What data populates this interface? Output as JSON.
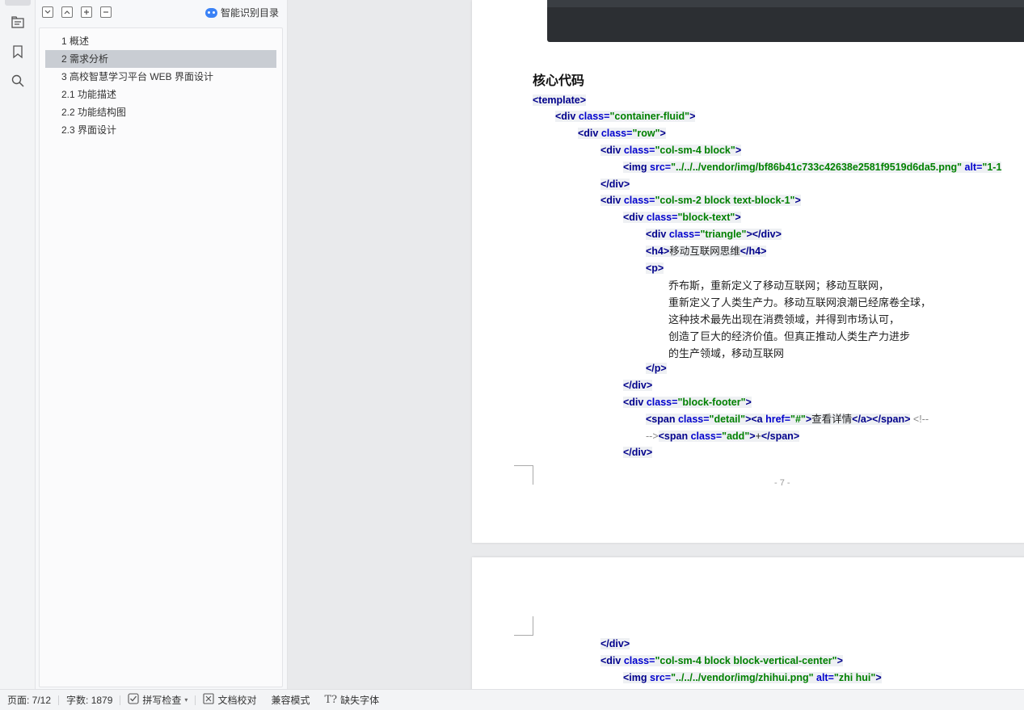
{
  "rail": {
    "icons": [
      "outline-icon",
      "bookmark-icon",
      "search-icon"
    ]
  },
  "panel": {
    "tools": [
      "collapse-all",
      "expand-up",
      "add",
      "remove"
    ],
    "smart_toc_label": "智能识别目录",
    "outline": [
      {
        "label": "1  概述",
        "selected": false
      },
      {
        "label": "2  需求分析",
        "selected": true
      },
      {
        "label": "3  高校智慧学习平台 WEB 界面设计",
        "selected": false
      },
      {
        "label": "2.1  功能描述",
        "selected": false
      },
      {
        "label": "2.2  功能结构图",
        "selected": false
      },
      {
        "label": "2.3 界面设计",
        "selected": false
      }
    ]
  },
  "doc": {
    "heading": "核心代码",
    "page_number": "- 7 -",
    "para": [
      "乔布斯，重新定义了移动互联网；移动互联网，",
      "重新定义了人类生产力。移动互联网浪潮已经席卷全球，",
      "这种技术最先出现在消费领域，并得到市场认可，",
      "创造了巨大的经济价值。但真正推动人类生产力进步",
      "的生产领域，移动互联网"
    ],
    "code": {
      "template_open": "<template>",
      "div_container": [
        "<div ",
        "class=",
        "\"container-fluid\"",
        ">"
      ],
      "div_row": [
        "<div ",
        "class=",
        "\"row\"",
        ">"
      ],
      "div_col4": [
        "<div ",
        "class=",
        "\"col-sm-4 block\"",
        ">"
      ],
      "img1": [
        "<img ",
        "src=",
        "\"../../../vendor/img/bf86b41c733c42638e2581f9519d6da5.png\"",
        " alt=",
        "\"1-1"
      ],
      "div_close": "</div>",
      "div_col2": [
        "<div ",
        "class=",
        "\"col-sm-2 block text-block-1\"",
        ">"
      ],
      "div_blocktext": [
        "<div ",
        "class=",
        "\"block-text\"",
        ">"
      ],
      "div_triangle": [
        "<div ",
        "class=",
        "\"triangle\"",
        "></div>"
      ],
      "h4": [
        "<h4>",
        "移动互联网思维",
        "</h4>"
      ],
      "p_open": "<p>",
      "p_close": "</p>",
      "div_footer": [
        "<div ",
        "class=",
        "\"block-footer\"",
        ">"
      ],
      "span_detail": [
        "<span ",
        "class=",
        "\"detail\"",
        "><a ",
        "href=",
        "\"#\"",
        ">",
        "查看详情",
        "</a></span>",
        " <!--"
      ],
      "span_add": [
        "-->",
        "<span ",
        "class=",
        "\"add\"",
        ">",
        "+",
        "</span>"
      ],
      "div_col4_vc": [
        "<div ",
        "class=",
        "\"col-sm-4 block block-vertical-center\"",
        ">"
      ],
      "img2": [
        "<img ",
        "src=",
        "\"../../../vendor/img/zhihui.png\"",
        " alt=",
        "\"zhi hui\"",
        ">"
      ]
    }
  },
  "status": {
    "page": "页面: 7/12",
    "words": "字数: 1879",
    "spell": "拼写检查",
    "proof": "文档校对",
    "compat": "兼容模式",
    "missing_font": "缺失字体"
  }
}
